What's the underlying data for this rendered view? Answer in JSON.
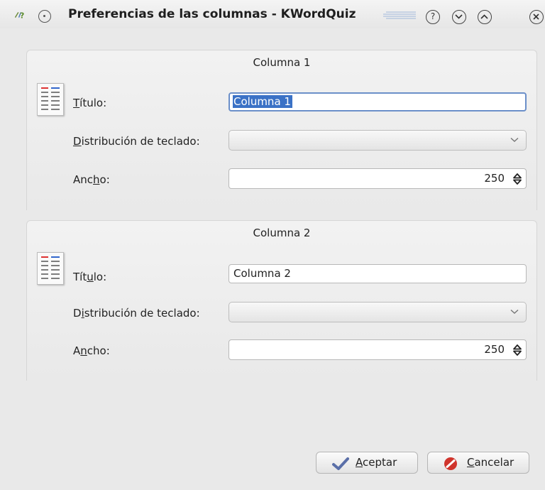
{
  "window": {
    "title": "Preferencias de las columnas - KWordQuiz"
  },
  "groups": [
    {
      "heading": "Columna 1",
      "title_label_pre": "",
      "title_label_mn": "T",
      "title_label_post": "ítulo:",
      "title_value": "Columna 1",
      "layout_label_pre": "",
      "layout_label_mn": "D",
      "layout_label_post": "istribución de teclado:",
      "layout_value": "",
      "width_label_pre": "Anc",
      "width_label_mn": "h",
      "width_label_post": "o:",
      "width_value": "250"
    },
    {
      "heading": "Columna 2",
      "title_label_pre": "Tít",
      "title_label_mn": "u",
      "title_label_post": "lo:",
      "title_value": "Columna 2",
      "layout_label_pre": "D",
      "layout_label_mn": "i",
      "layout_label_post": "stribución de teclado:",
      "layout_value": "",
      "width_label_pre": "A",
      "width_label_mn": "n",
      "width_label_post": "cho:",
      "width_value": "250"
    }
  ],
  "buttons": {
    "ok_pre": "",
    "ok_mn": "A",
    "ok_post": "ceptar",
    "cancel_pre": "",
    "cancel_mn": "C",
    "cancel_post": "ancelar"
  },
  "colors": {
    "selection": "#3b72c6",
    "focus_border": "#6b8fc9",
    "cancel_icon": "#d0342c",
    "ok_icon": "#5a6fa8"
  }
}
